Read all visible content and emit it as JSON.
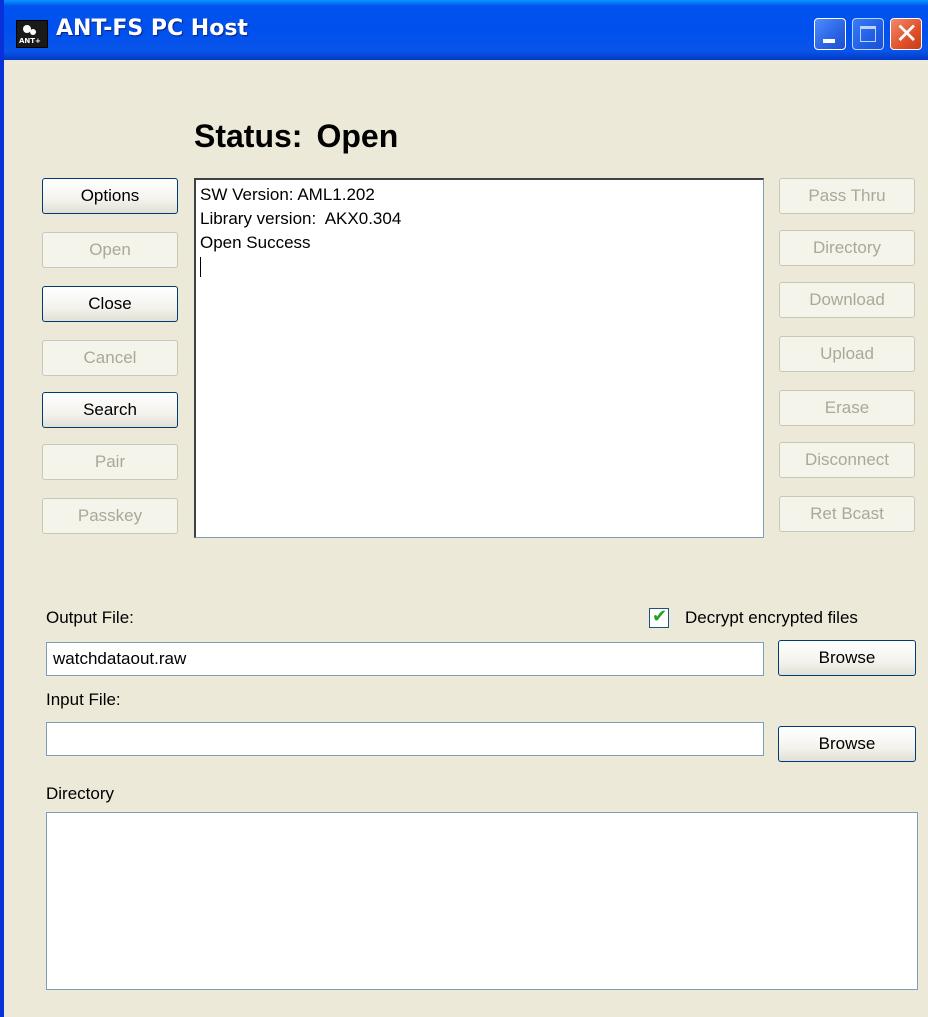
{
  "window": {
    "title": "ANT-FS PC Host",
    "icon": "ant-icon"
  },
  "status": {
    "label": "Status:",
    "value": "Open"
  },
  "left_buttons": [
    {
      "label": "Options",
      "hint": "O",
      "enabled": true
    },
    {
      "label": "Open",
      "hint": "O",
      "enabled": false
    },
    {
      "label": "Close",
      "hint": "C",
      "enabled": true
    },
    {
      "label": "Cancel",
      "hint": "n",
      "enabled": false
    },
    {
      "label": "Search",
      "hint": "S",
      "enabled": true
    },
    {
      "label": "Pair",
      "hint": "P",
      "enabled": false
    },
    {
      "label": "Passkey",
      "hint": "a",
      "enabled": false
    }
  ],
  "right_buttons": [
    {
      "label": "Pass Thru",
      "enabled": false
    },
    {
      "label": "Directory",
      "enabled": false
    },
    {
      "label": "Download",
      "enabled": false
    },
    {
      "label": "Upload",
      "enabled": false
    },
    {
      "label": "Erase",
      "enabled": false
    },
    {
      "label": "Disconnect",
      "enabled": false
    },
    {
      "label": "Ret Bcast",
      "enabled": false
    }
  ],
  "log_lines": [
    "SW Version: AML1.202",
    "Library version:  AKX0.304",
    "Open Success"
  ],
  "output_file": {
    "label": "Output File:",
    "value": "watchdataout.raw",
    "browse_label": "Browse"
  },
  "decrypt": {
    "label": "Decrypt encrypted files",
    "checked": true
  },
  "input_file": {
    "label": "Input File:",
    "value": "",
    "browse_label": "Browse"
  },
  "directory": {
    "label": "Directory"
  }
}
